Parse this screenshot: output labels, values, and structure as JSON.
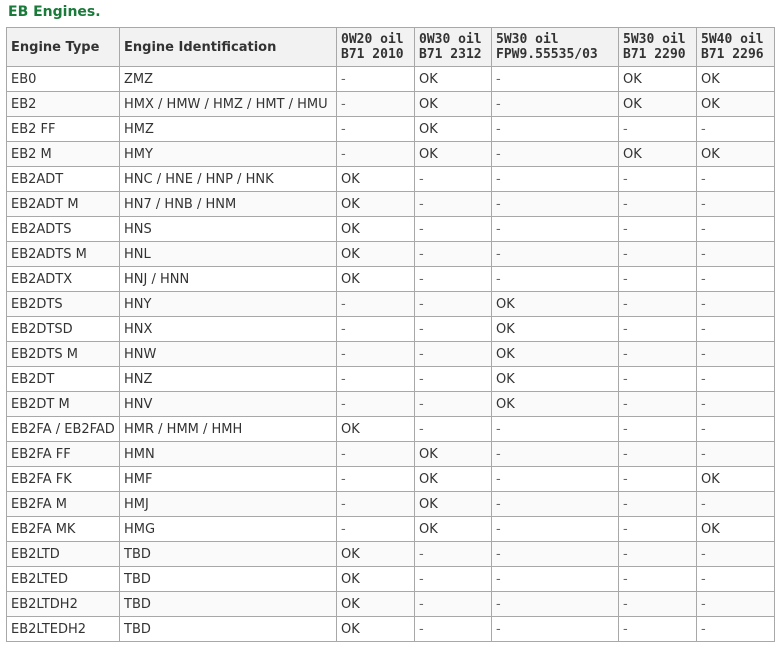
{
  "title": "EB Engines.",
  "table": {
    "headers": {
      "engine_type": "Engine Type",
      "engine_id": "Engine Identification",
      "oil": [
        {
          "line1": "0W20 oil",
          "line2": "B71 2010"
        },
        {
          "line1": "0W30 oil",
          "line2": "B71 2312"
        },
        {
          "line1": "5W30 oil",
          "line2": "FPW9.55535/03"
        },
        {
          "line1": "5W30 oil",
          "line2": "B71 2290"
        },
        {
          "line1": "5W40 oil",
          "line2": "B71 2296"
        }
      ]
    },
    "rows": [
      {
        "type": "EB0",
        "id": "ZMZ",
        "oils": [
          "-",
          "OK",
          "-",
          "OK",
          "OK"
        ]
      },
      {
        "type": "EB2",
        "id": "HMX / HMW / HMZ / HMT / HMU",
        "oils": [
          "-",
          "OK",
          "-",
          "OK",
          "OK"
        ]
      },
      {
        "type": "EB2 FF",
        "id": "HMZ",
        "oils": [
          "-",
          "OK",
          "-",
          "-",
          "-"
        ]
      },
      {
        "type": "EB2 M",
        "id": "HMY",
        "oils": [
          "-",
          "OK",
          "-",
          "OK",
          "OK"
        ]
      },
      {
        "type": "EB2ADT",
        "id": "HNC / HNE / HNP / HNK",
        "oils": [
          "OK",
          "-",
          "-",
          "-",
          "-"
        ]
      },
      {
        "type": "EB2ADT M",
        "id": "HN7 / HNB / HNM",
        "oils": [
          "OK",
          "-",
          "-",
          "-",
          "-"
        ]
      },
      {
        "type": "EB2ADTS",
        "id": "HNS",
        "oils": [
          "OK",
          "-",
          "-",
          "-",
          "-"
        ]
      },
      {
        "type": "EB2ADTS M",
        "id": "HNL",
        "oils": [
          "OK",
          "-",
          "-",
          "-",
          "-"
        ]
      },
      {
        "type": "EB2ADTX",
        "id": "HNJ / HNN",
        "oils": [
          "OK",
          "-",
          "-",
          "-",
          "-"
        ]
      },
      {
        "type": "EB2DTS",
        "id": "HNY",
        "oils": [
          "-",
          "-",
          "OK",
          "-",
          "-"
        ]
      },
      {
        "type": "EB2DTSD",
        "id": "HNX",
        "oils": [
          "-",
          "-",
          "OK",
          "-",
          "-"
        ]
      },
      {
        "type": "EB2DTS M",
        "id": "HNW",
        "oils": [
          "-",
          "-",
          "OK",
          "-",
          "-"
        ]
      },
      {
        "type": "EB2DT",
        "id": "HNZ",
        "oils": [
          "-",
          "-",
          "OK",
          "-",
          "-"
        ]
      },
      {
        "type": "EB2DT M",
        "id": "HNV",
        "oils": [
          "-",
          "-",
          "OK",
          "-",
          "-"
        ]
      },
      {
        "type": "EB2FA / EB2FAD",
        "id": "HMR / HMM / HMH",
        "oils": [
          "OK",
          "-",
          "-",
          "-",
          "-"
        ]
      },
      {
        "type": "EB2FA FF",
        "id": "HMN",
        "oils": [
          "-",
          "OK",
          "-",
          "-",
          "-"
        ]
      },
      {
        "type": "EB2FA FK",
        "id": "HMF",
        "oils": [
          "-",
          "OK",
          "-",
          "-",
          "OK"
        ]
      },
      {
        "type": "EB2FA M",
        "id": "HMJ",
        "oils": [
          "-",
          "OK",
          "-",
          "-",
          "-"
        ]
      },
      {
        "type": "EB2FA MK",
        "id": "HMG",
        "oils": [
          "-",
          "OK",
          "-",
          "-",
          "OK"
        ]
      },
      {
        "type": "EB2LTD",
        "id": "TBD",
        "oils": [
          "OK",
          "-",
          "-",
          "-",
          "-"
        ]
      },
      {
        "type": "EB2LTED",
        "id": "TBD",
        "oils": [
          "OK",
          "-",
          "-",
          "-",
          "-"
        ]
      },
      {
        "type": "EB2LTDH2",
        "id": "TBD",
        "oils": [
          "OK",
          "-",
          "-",
          "-",
          "-"
        ]
      },
      {
        "type": "EB2LTEDH2",
        "id": "TBD",
        "oils": [
          "OK",
          "-",
          "-",
          "-",
          "-"
        ]
      }
    ]
  },
  "colors": {
    "title": "#1a7a3a",
    "border": "#a8a8a8",
    "header_bg": "#f2f2f2"
  }
}
